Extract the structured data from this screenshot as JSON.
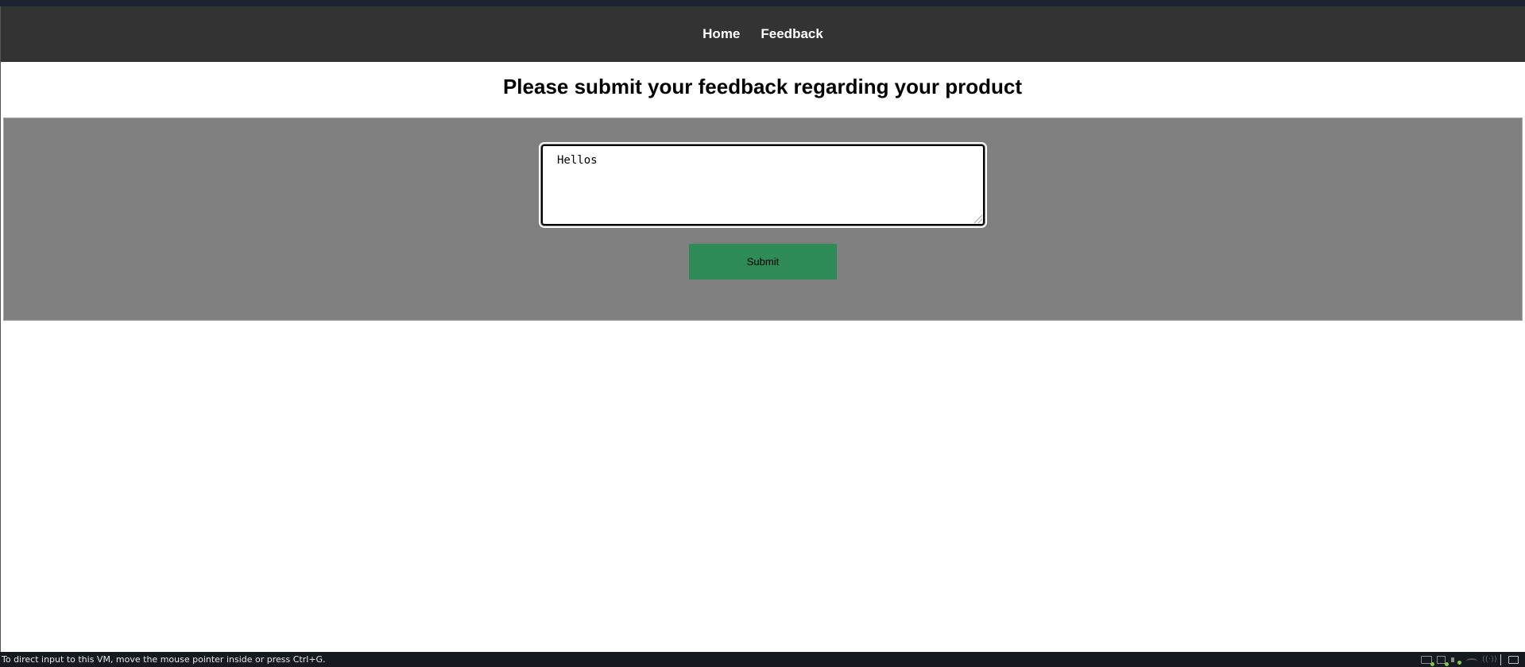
{
  "nav": {
    "links": [
      {
        "label": "Home"
      },
      {
        "label": "Feedback"
      }
    ]
  },
  "page": {
    "heading": "Please submit your feedback regarding your product"
  },
  "form": {
    "feedback_value": "Hellos",
    "submit_label": "Submit"
  },
  "statusbar": {
    "text": "To direct input to this VM, move the mouse pointer inside or press Ctrl+G.",
    "tray_icons": [
      "hard-disk-icon",
      "network-adapter-icon",
      "sound-card-icon",
      "usb-controller-icon",
      "wireless-icon",
      "message-icon"
    ]
  },
  "colors": {
    "navbar_bg": "#333333",
    "panel_bg": "#808080",
    "submit_bg": "#2e8b57",
    "status_bg": "#16191f"
  }
}
